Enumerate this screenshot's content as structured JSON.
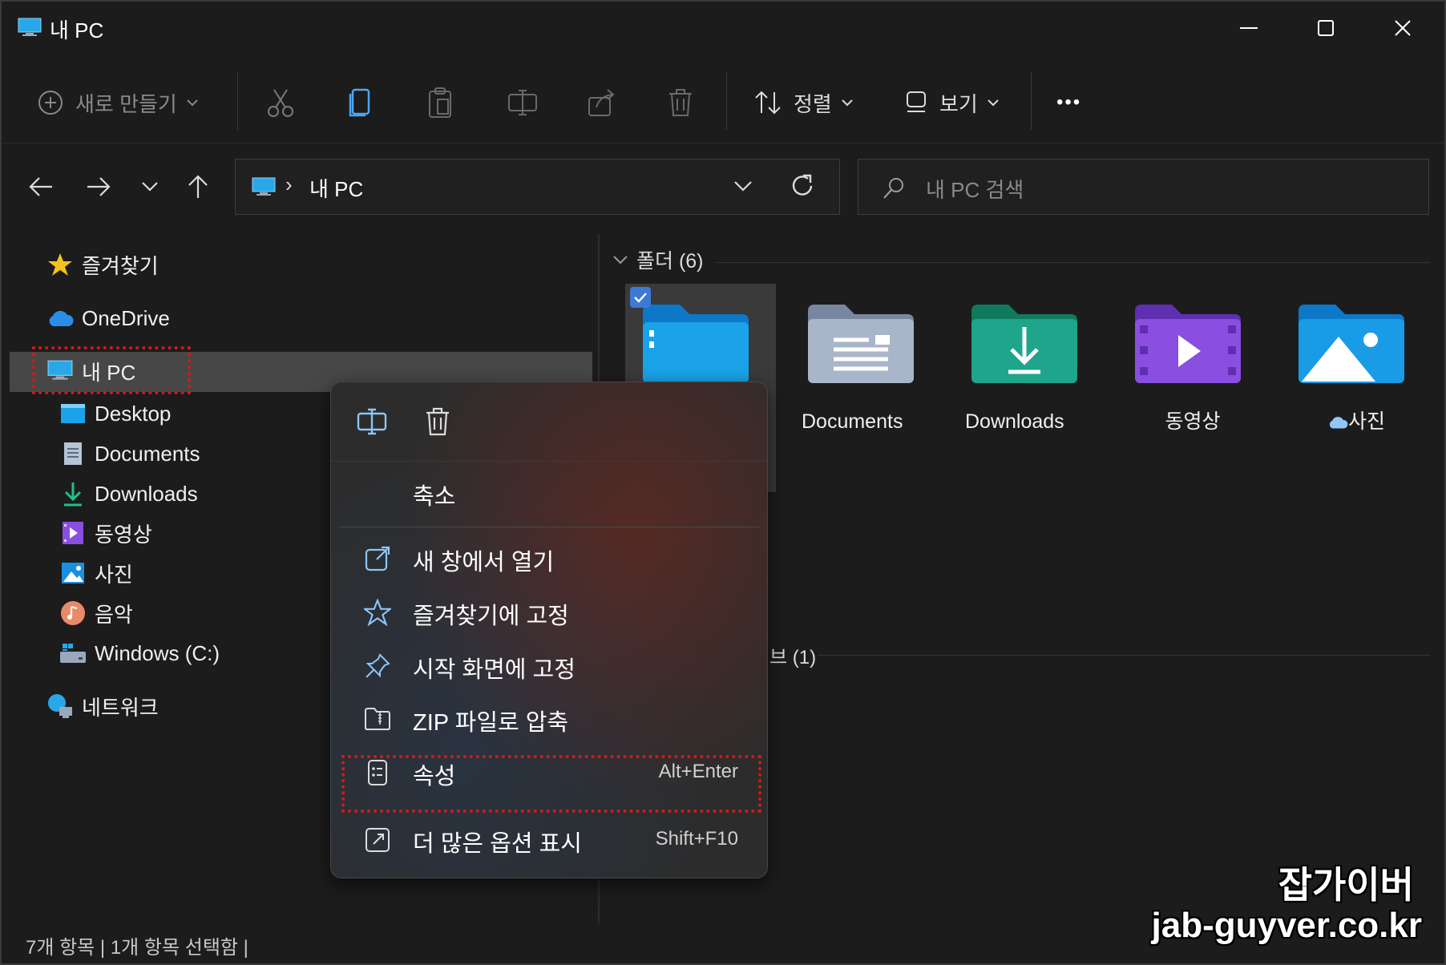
{
  "window": {
    "title": "내 PC"
  },
  "commandbar": {
    "new_label": "새로 만들기",
    "sort_label": "정렬",
    "view_label": "보기",
    "more_label": "•••"
  },
  "address": {
    "path_label": "내 PC",
    "search_placeholder": "내 PC 검색"
  },
  "sidebar": {
    "favorites": "즐겨찾기",
    "onedrive": "OneDrive",
    "this_pc": "내 PC",
    "children": [
      "Desktop",
      "Documents",
      "Downloads",
      "동영상",
      "사진",
      "음악",
      "Windows (C:)"
    ],
    "network": "네트워크"
  },
  "content": {
    "folders_header": "폴더 (6)",
    "drives_header_partial": "브 (1)",
    "folders": [
      {
        "name": "",
        "icon": "desktop-folder-icon",
        "color": "#1aa3e8"
      },
      {
        "name": "Documents",
        "icon": "documents-folder-icon",
        "color": "#9aa8bd"
      },
      {
        "name": "Downloads",
        "icon": "downloads-folder-icon",
        "color": "#1fa58b"
      },
      {
        "name": "동영상",
        "icon": "videos-folder-icon",
        "color": "#8a4ee0"
      },
      {
        "name": "사진",
        "icon": "pictures-folder-icon",
        "color": "#1aa3e8"
      }
    ]
  },
  "context_menu": {
    "items": [
      {
        "label": "축소",
        "shortcut": ""
      },
      {
        "label": "새 창에서 열기",
        "shortcut": ""
      },
      {
        "label": "즐겨찾기에 고정",
        "shortcut": ""
      },
      {
        "label": "시작 화면에 고정",
        "shortcut": ""
      },
      {
        "label": "ZIP 파일로 압축",
        "shortcut": ""
      },
      {
        "label": "속성",
        "shortcut": "Alt+Enter"
      },
      {
        "label": "더 많은 옵션 표시",
        "shortcut": "Shift+F10"
      }
    ]
  },
  "statusbar": {
    "text": "7개 항목  |  1개 항목 선택함  |"
  },
  "watermark": {
    "line1": "잡가이버",
    "line2": "jab-guyver.co.kr"
  },
  "colors": {
    "accent": "#3c7ad6",
    "highlight": "#d21a1a"
  }
}
